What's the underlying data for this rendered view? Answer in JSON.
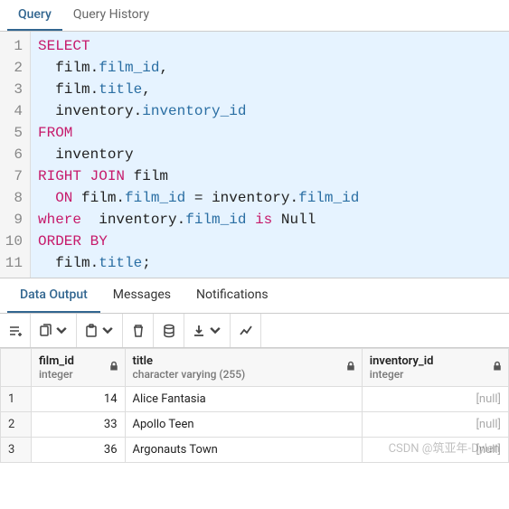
{
  "tabs": {
    "query": "Query",
    "history": "Query History"
  },
  "code": {
    "lines": [
      "1",
      "2",
      "3",
      "4",
      "5",
      "6",
      "7",
      "8",
      "9",
      "10",
      "11"
    ],
    "l1_kw": "SELECT",
    "l2_t": "film",
    "l2_f": "film_id",
    "l3_t": "film",
    "l3_f": "title",
    "l4_t": "inventory",
    "l4_f": "inventory_id",
    "l5_kw": "FROM",
    "l6_t": "inventory",
    "l7_kw": "RIGHT JOIN",
    "l7_t": "film",
    "l8_kw": "ON",
    "l8_t1": "film",
    "l8_f1": "film_id",
    "l8_eq": " = ",
    "l8_t2": "inventory",
    "l8_f2": "film_id",
    "l9_kw1": "where",
    "l9_t": "inventory",
    "l9_f": "film_id",
    "l9_kw2": "is",
    "l9_null": "Null",
    "l10_kw": "ORDER BY",
    "l11_t": "film",
    "l11_f": "title"
  },
  "lowerTabs": {
    "data": "Data Output",
    "messages": "Messages",
    "notifications": "Notifications"
  },
  "toolbar": {
    "addRow": "add-row",
    "copy": "copy",
    "paste": "paste",
    "delete": "delete",
    "save": "save",
    "download": "download",
    "chart": "chart"
  },
  "columns": [
    {
      "name": "film_id",
      "type": "integer"
    },
    {
      "name": "title",
      "type": "character varying (255)"
    },
    {
      "name": "inventory_id",
      "type": "integer"
    }
  ],
  "rows": [
    {
      "n": "1",
      "film_id": "14",
      "title": "Alice Fantasia",
      "inventory_id": "[null]"
    },
    {
      "n": "2",
      "film_id": "33",
      "title": "Apollo Teen",
      "inventory_id": "[null]"
    },
    {
      "n": "3",
      "film_id": "36",
      "title": "Argonauts Town",
      "inventory_id": "[null]"
    }
  ],
  "watermark": "CSDN @筑亚年-Dylen"
}
